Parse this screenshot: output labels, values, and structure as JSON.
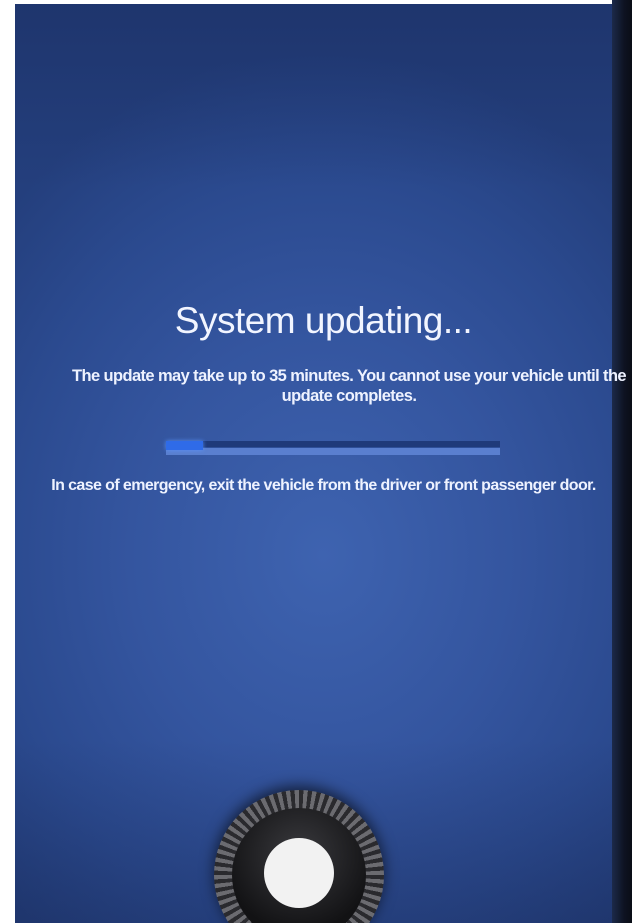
{
  "screen": {
    "title": "System updating...",
    "message_line1": "The update may take up to 35 minutes. You cannot use your vehicle until the",
    "message_line2": "update completes.",
    "progress_percent": 11,
    "emergency_text": "In case of emergency, exit the vehicle from the driver or front passenger door.",
    "background_color": "#34559f",
    "accent_color": "#2f6be8"
  },
  "hardware": {
    "knob_icon": "volume-knob-icon"
  }
}
